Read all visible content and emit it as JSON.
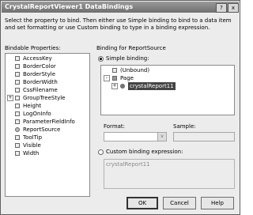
{
  "window": {
    "title": "CrystalReportViewer1 DataBindings",
    "help_glyph": "?",
    "close_glyph": "x"
  },
  "description": "Select the property to bind. Then either use Simple binding to bind to a data item and set formatting or use Custom binding to type in a binding expression.",
  "bindable": {
    "label": "Bindable Properties:",
    "items": [
      {
        "label": "AccessKey",
        "expand": ""
      },
      {
        "label": "BorderColor",
        "expand": ""
      },
      {
        "label": "BorderStyle",
        "expand": ""
      },
      {
        "label": "BorderWidth",
        "expand": ""
      },
      {
        "label": "CssFilename",
        "expand": ""
      },
      {
        "label": "GroupTreeStyle",
        "expand": "+"
      },
      {
        "label": "Height",
        "expand": ""
      },
      {
        "label": "LogOnInfo",
        "expand": ""
      },
      {
        "label": "ParameterFieldInfo",
        "expand": ""
      },
      {
        "label": "ReportSource",
        "expand": ""
      },
      {
        "label": "ToolTip",
        "expand": ""
      },
      {
        "label": "Visible",
        "expand": ""
      },
      {
        "label": "Width",
        "expand": ""
      }
    ]
  },
  "binding": {
    "group_label": "Binding for ReportSource",
    "simple_label": "Simple binding:",
    "tree": {
      "unbound": "(Unbound)",
      "page": "Page",
      "report": "crystalReport11",
      "expand_minus": "-",
      "expand_plus": "+"
    },
    "format_label": "Format:",
    "sample_label": "Sample:",
    "dropdown_glyph": "v",
    "custom_label": "Custom binding expression:",
    "custom_value": "crystalReport11"
  },
  "buttons": {
    "ok": "OK",
    "cancel": "Cancel",
    "help": "Help"
  }
}
